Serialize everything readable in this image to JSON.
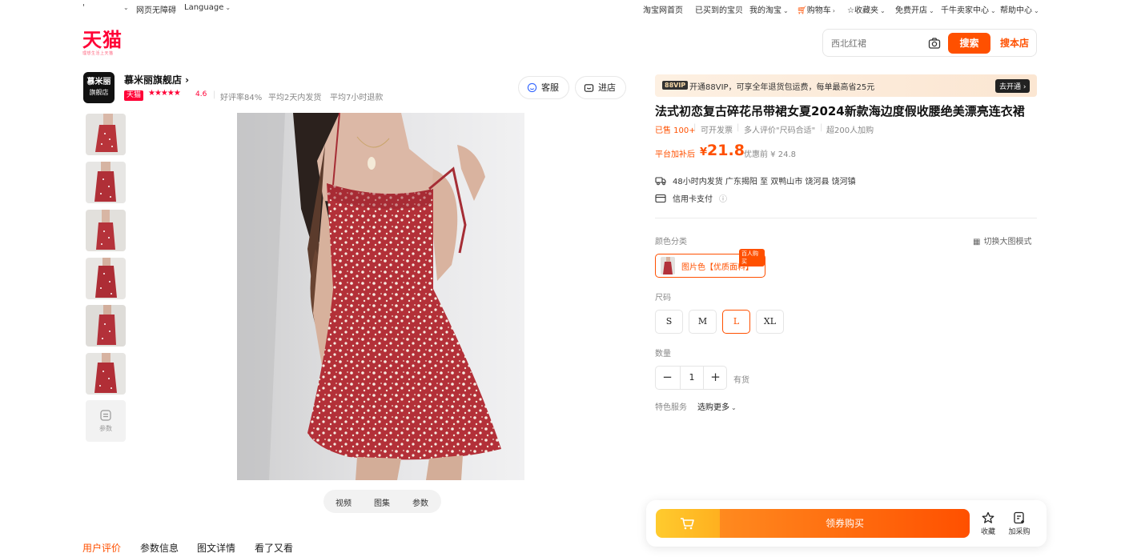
{
  "topbar": {
    "left_mark": "'",
    "accessibility": "网页无障碍",
    "language": "Language",
    "taobao_home": "淘宝网首页",
    "bought": "已买到的宝贝",
    "my_taobao": "我的淘宝",
    "cart": "购物车",
    "favorites": "收藏夹",
    "open_store": "免费开店",
    "seller_center": "千牛卖家中心",
    "help_center": "帮助中心"
  },
  "logo": {
    "text": "天猫",
    "slogan": "理想生活上天猫",
    "color": "#ff0036"
  },
  "search": {
    "placeholder": "西北红裙",
    "search_label": "搜索",
    "search_shop_label": "搜本店",
    "accent": "#ff5000"
  },
  "shop": {
    "logo_line1": "慕米丽",
    "logo_line2": "旗舰店",
    "name": "慕米丽旗舰店 ›",
    "badge": "天猫",
    "stars": "★★★★★",
    "rating": "4.6",
    "good_rate": "好评率84%",
    "ship_avg": "平均2天内发货",
    "refund_avg": "平均7小时退款",
    "service_label": "客服",
    "enter_label": "进店"
  },
  "gallery": {
    "params_label": "参数",
    "tabs": [
      "视频",
      "图集",
      "参数"
    ]
  },
  "bottom_tabs": [
    "用户评价",
    "参数信息",
    "图文详情",
    "看了又看"
  ],
  "product": {
    "vip_badge": "88VIP",
    "vip_text": "开通88VIP，可享全年退货包运费，每单最高省25元",
    "vip_go": "去开通 ›",
    "title": "法式初恋复古碎花吊带裙女夏2024新款海边度假收腰绝美漂亮连衣裙",
    "sold": "已售 100+",
    "invoice": "可开发票",
    "review_hint": "多人评价\"尺码合适\"",
    "cart_count": "超200人加购",
    "price_label": "平台加补后",
    "price_currency": "¥",
    "price": "21.8",
    "orig_price": "优惠前 ¥ 24.8",
    "shipping": "48小时内发货  广东揭阳 至 双鸭山市 饶河县 饶河镇",
    "payment": "信用卡支付",
    "color_label": "颜色分类",
    "switch_view": "切换大图模式",
    "color_option": "图片色【优质面料】",
    "color_tag": "百人购买",
    "size_label": "尺码",
    "sizes": [
      "S",
      "M",
      "L",
      "XL"
    ],
    "selected_size": "L",
    "qty_label": "数量",
    "qty_minus": "−",
    "qty_value": "1",
    "qty_plus": "+",
    "stock": "有货",
    "service_label": "特色服务",
    "service_more": "选购更多"
  },
  "buybar": {
    "buy_label": "领券购买",
    "favorite_label": "收藏",
    "add_purchase_label": "加采购"
  }
}
